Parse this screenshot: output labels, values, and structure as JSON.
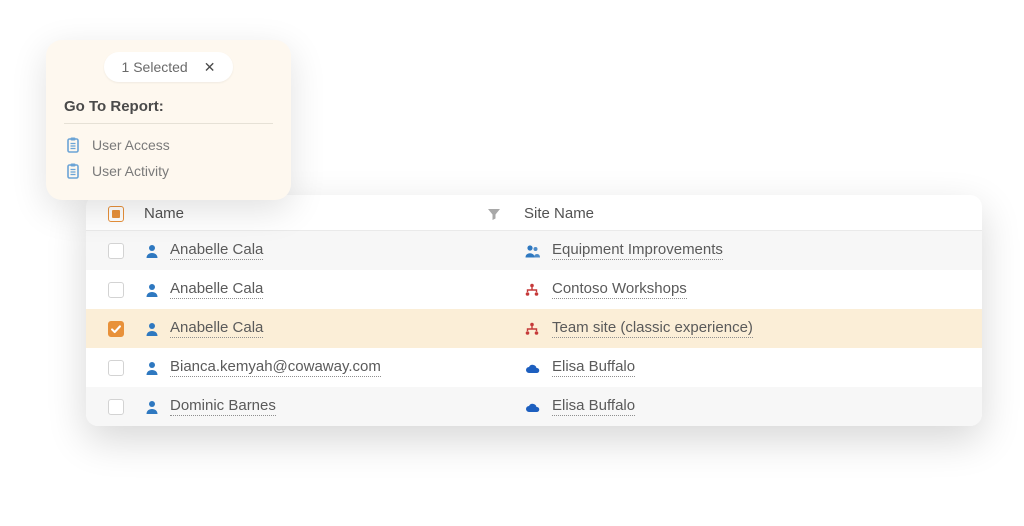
{
  "popup": {
    "selected_label": "1 Selected",
    "close_glyph": "✕",
    "title": "Go To Report:",
    "links": [
      {
        "label": "User Access",
        "icon": "clipboard-icon"
      },
      {
        "label": "User Activity",
        "icon": "clipboard-icon"
      }
    ]
  },
  "table": {
    "columns": {
      "name": "Name",
      "site": "Site Name"
    },
    "header_check_state": "indeterminate",
    "rows": [
      {
        "checked": false,
        "selected": false,
        "alt": true,
        "name": "Anabelle Cala",
        "name_icon": "user",
        "site": "Equipment Improvements",
        "site_icon": "group"
      },
      {
        "checked": false,
        "selected": false,
        "alt": false,
        "name": "Anabelle Cala",
        "name_icon": "user",
        "site": "Contoso Workshops",
        "site_icon": "org"
      },
      {
        "checked": true,
        "selected": true,
        "alt": false,
        "name": "Anabelle Cala",
        "name_icon": "user",
        "site": "Team site (classic experience)",
        "site_icon": "org"
      },
      {
        "checked": false,
        "selected": false,
        "alt": false,
        "name": "Bianca.kemyah@cowaway.com",
        "name_icon": "user",
        "site": "Elisa Buffalo",
        "site_icon": "cloud"
      },
      {
        "checked": false,
        "selected": false,
        "alt": true,
        "name": "Dominic Barnes",
        "name_icon": "user",
        "site": "Elisa Buffalo",
        "site_icon": "cloud"
      }
    ]
  },
  "colors": {
    "accent_orange": "#e8913a",
    "link_gray": "#5a5a5a",
    "user_blue": "#2e78c0",
    "group_blue": "#2e78c0",
    "org_red": "#c53939",
    "cloud_blue": "#1d5fbf"
  }
}
